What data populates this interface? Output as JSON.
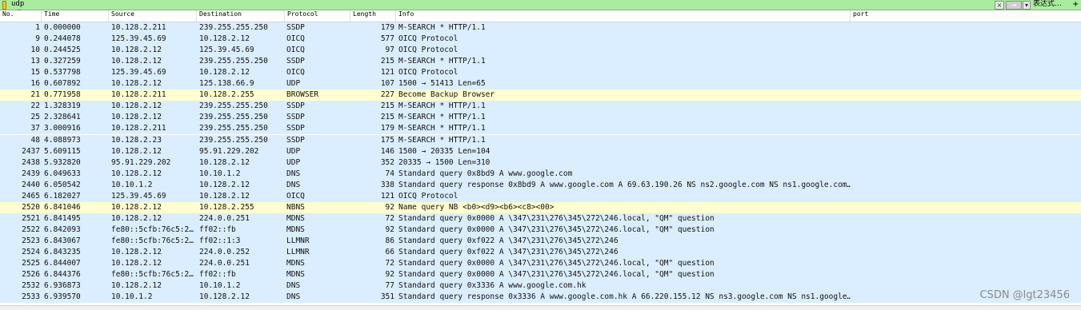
{
  "filter": {
    "value": "udp",
    "expression_label": "表达式…",
    "plus": "+",
    "clear": "×",
    "apply": "→",
    "dropdown": "▾"
  },
  "columns": [
    "No.",
    "Time",
    "Source",
    "Destination",
    "Protocol",
    "Length",
    "Info",
    "port"
  ],
  "sort_indicator": "^",
  "colors": {
    "filter_bg": "#a9ec9f",
    "udp_row": "#daeeff",
    "highlight_row": "#fffed0"
  },
  "packets": [
    {
      "no": "1",
      "time": "0.000000",
      "src": "10.128.2.211",
      "dst": "239.255.255.250",
      "proto": "SSDP",
      "len": "179",
      "info": "M-SEARCH * HTTP/1.1",
      "hl": false
    },
    {
      "no": "9",
      "time": "0.244078",
      "src": "125.39.45.69",
      "dst": "10.128.2.12",
      "proto": "OICQ",
      "len": "577",
      "info": "OICQ Protocol",
      "hl": false
    },
    {
      "no": "10",
      "time": "0.244525",
      "src": "10.128.2.12",
      "dst": "125.39.45.69",
      "proto": "OICQ",
      "len": "97",
      "info": "OICQ Protocol",
      "hl": false
    },
    {
      "no": "13",
      "time": "0.327259",
      "src": "10.128.2.12",
      "dst": "239.255.255.250",
      "proto": "SSDP",
      "len": "215",
      "info": "M-SEARCH * HTTP/1.1",
      "hl": false
    },
    {
      "no": "15",
      "time": "0.537798",
      "src": "125.39.45.69",
      "dst": "10.128.2.12",
      "proto": "OICQ",
      "len": "121",
      "info": "OICQ Protocol",
      "hl": false
    },
    {
      "no": "16",
      "time": "0.607892",
      "src": "10.128.2.12",
      "dst": "125.138.66.9",
      "proto": "UDP",
      "len": "107",
      "info": "1500 → 51413 Len=65",
      "hl": false
    },
    {
      "no": "21",
      "time": "0.771958",
      "src": "10.128.2.211",
      "dst": "10.128.2.255",
      "proto": "BROWSER",
      "len": "227",
      "info": "Become Backup Browser",
      "hl": true
    },
    {
      "no": "22",
      "time": "1.328319",
      "src": "10.128.2.12",
      "dst": "239.255.255.250",
      "proto": "SSDP",
      "len": "215",
      "info": "M-SEARCH * HTTP/1.1",
      "hl": false
    },
    {
      "no": "25",
      "time": "2.328641",
      "src": "10.128.2.12",
      "dst": "239.255.255.250",
      "proto": "SSDP",
      "len": "215",
      "info": "M-SEARCH * HTTP/1.1",
      "hl": false
    },
    {
      "no": "37",
      "time": "3.000916",
      "src": "10.128.2.211",
      "dst": "239.255.255.250",
      "proto": "SSDP",
      "len": "179",
      "info": "M-SEARCH * HTTP/1.1",
      "hl": false
    },
    {
      "no": "48",
      "time": "4.088973",
      "src": "10.128.2.23",
      "dst": "239.255.255.250",
      "proto": "SSDP",
      "len": "175",
      "info": "M-SEARCH * HTTP/1.1",
      "hl": false
    },
    {
      "no": "2437",
      "time": "5.609115",
      "src": "10.128.2.12",
      "dst": "95.91.229.202",
      "proto": "UDP",
      "len": "146",
      "info": "1500 → 20335 Len=104",
      "hl": false
    },
    {
      "no": "2438",
      "time": "5.932820",
      "src": "95.91.229.202",
      "dst": "10.128.2.12",
      "proto": "UDP",
      "len": "352",
      "info": "20335 → 1500 Len=310",
      "hl": false
    },
    {
      "no": "2439",
      "time": "6.049633",
      "src": "10.128.2.12",
      "dst": "10.10.1.2",
      "proto": "DNS",
      "len": "74",
      "info": "Standard query 0x8bd9 A www.google.com",
      "hl": false
    },
    {
      "no": "2440",
      "time": "6.050542",
      "src": "10.10.1.2",
      "dst": "10.128.2.12",
      "proto": "DNS",
      "len": "338",
      "info": "Standard query response 0x8bd9 A www.google.com A 69.63.190.26 NS ns2.google.com NS ns1.google.com…",
      "hl": false
    },
    {
      "no": "2465",
      "time": "6.182027",
      "src": "125.39.45.69",
      "dst": "10.128.2.12",
      "proto": "OICQ",
      "len": "121",
      "info": "OICQ Protocol",
      "hl": false
    },
    {
      "no": "2520",
      "time": "6.841046",
      "src": "10.128.2.12",
      "dst": "10.128.2.255",
      "proto": "NBNS",
      "len": "92",
      "info": "Name query NB <b0><d9><b6><c8><00>",
      "hl": true
    },
    {
      "no": "2521",
      "time": "6.841495",
      "src": "10.128.2.12",
      "dst": "224.0.0.251",
      "proto": "MDNS",
      "len": "72",
      "info": "Standard query 0x0000 A \\347\\231\\276\\345\\272\\246.local, \"QM\" question",
      "hl": false
    },
    {
      "no": "2522",
      "time": "6.842093",
      "src": "fe80::5cfb:76c5:2…",
      "dst": "ff02::fb",
      "proto": "MDNS",
      "len": "92",
      "info": "Standard query 0x0000 A \\347\\231\\276\\345\\272\\246.local, \"QM\" question",
      "hl": false
    },
    {
      "no": "2523",
      "time": "6.843067",
      "src": "fe80::5cfb:76c5:2…",
      "dst": "ff02::1:3",
      "proto": "LLMNR",
      "len": "86",
      "info": "Standard query 0xf022 A \\347\\231\\276\\345\\272\\246",
      "hl": false
    },
    {
      "no": "2524",
      "time": "6.843235",
      "src": "10.128.2.12",
      "dst": "224.0.0.252",
      "proto": "LLMNR",
      "len": "66",
      "info": "Standard query 0xf022 A \\347\\231\\276\\345\\272\\246",
      "hl": false
    },
    {
      "no": "2525",
      "time": "6.844007",
      "src": "10.128.2.12",
      "dst": "224.0.0.251",
      "proto": "MDNS",
      "len": "72",
      "info": "Standard query 0x0000 A \\347\\231\\276\\345\\272\\246.local, \"QM\" question",
      "hl": false
    },
    {
      "no": "2526",
      "time": "6.844376",
      "src": "fe80::5cfb:76c5:2…",
      "dst": "ff02::fb",
      "proto": "MDNS",
      "len": "92",
      "info": "Standard query 0x0000 A \\347\\231\\276\\345\\272\\246.local, \"QM\" question",
      "hl": false
    },
    {
      "no": "2532",
      "time": "6.936873",
      "src": "10.128.2.12",
      "dst": "10.10.1.2",
      "proto": "DNS",
      "len": "77",
      "info": "Standard query 0x3336 A www.google.com.hk",
      "hl": false
    },
    {
      "no": "2533",
      "time": "6.939570",
      "src": "10.10.1.2",
      "dst": "10.128.2.12",
      "proto": "DNS",
      "len": "351",
      "info": "Standard query response 0x3336 A www.google.com.hk A 66.220.155.12 NS ns3.google.com NS ns1.google…",
      "hl": false
    }
  ],
  "watermark": "CSDN @lgt23456"
}
